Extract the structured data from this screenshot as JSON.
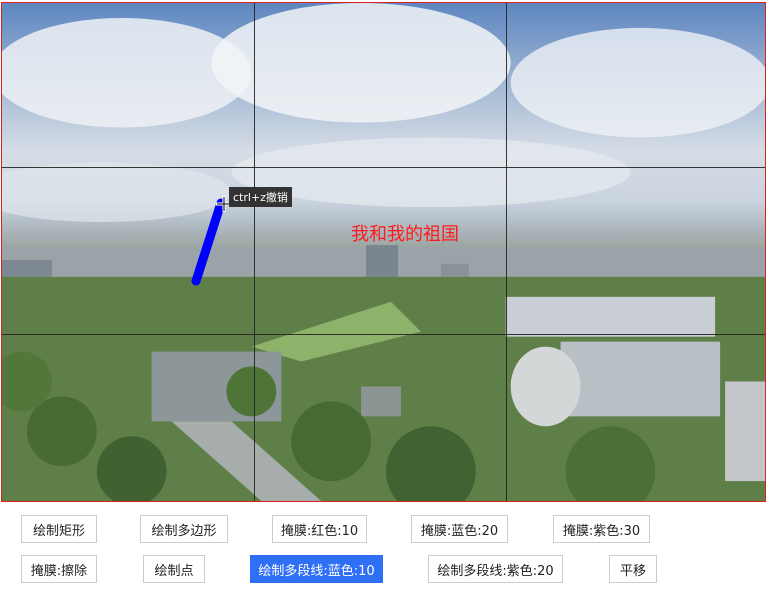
{
  "canvas": {
    "overlay_text": "我和我的祖国",
    "tooltip": "ctrl+z撤销",
    "border_color": "#e02020",
    "overlay_text_color": "#ff1a1a",
    "polyline_color": "#0000ff"
  },
  "toolbar": {
    "row1": [
      "绘制矩形",
      "绘制多边形",
      "掩膜:红色:10",
      "掩膜:蓝色:20",
      "掩膜:紫色:30"
    ],
    "row2": [
      "掩膜:擦除",
      "绘制点",
      "绘制多段线:蓝色:10",
      "绘制多段线:紫色:20",
      "平移"
    ],
    "active": "绘制多段线:蓝色:10",
    "active_color": "#2f6ff5"
  }
}
